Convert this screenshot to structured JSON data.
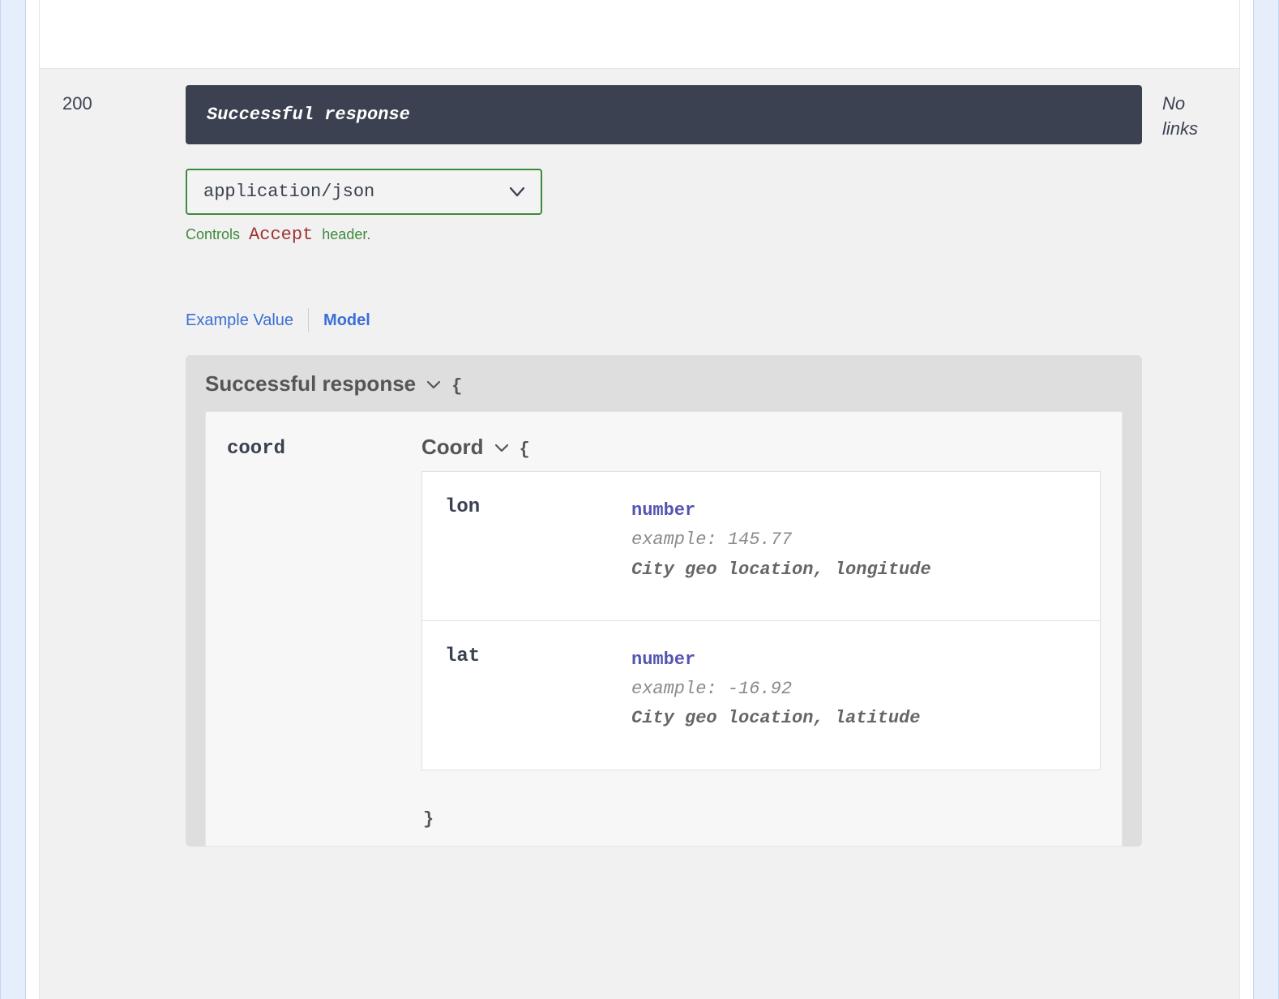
{
  "response": {
    "code": "200",
    "description": "Successful response",
    "links_label": "No links",
    "content_type": "application/json",
    "accept_note_prefix": "Controls",
    "accept_note_code": "Accept",
    "accept_note_suffix": "header."
  },
  "tabs": {
    "example_value": "Example Value",
    "model": "Model"
  },
  "model": {
    "title": "Successful response",
    "open_brace": "{",
    "close_brace": "}",
    "property_key": "coord",
    "sub_title": "Coord",
    "fields": [
      {
        "name": "lon",
        "type": "number",
        "example_label": "example: 145.77",
        "description": "City geo location, longitude"
      },
      {
        "name": "lat",
        "type": "number",
        "example_label": "example: -16.92",
        "description": "City geo location, latitude"
      }
    ]
  }
}
